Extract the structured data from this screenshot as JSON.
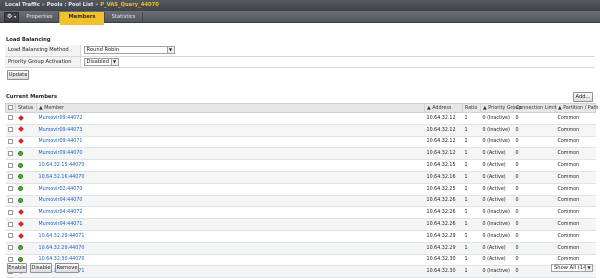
{
  "breadcrumb": {
    "part1": "Local Traffic",
    "sep": "»",
    "part2": "Pools : Pool List",
    "part3": "P_VAS_Query_44070"
  },
  "tabs": [
    {
      "label": "Properties"
    },
    {
      "label": "Members"
    },
    {
      "label": "Statistics"
    }
  ],
  "load_balancing": {
    "title": "Load Balancing",
    "method_label": "Load Balancing Method",
    "method_value": "Round Robin",
    "priority_label": "Priority Group Activation",
    "priority_value": "Disabled",
    "update_button": "Update"
  },
  "members": {
    "title": "Current Members",
    "add_button": "Add...",
    "columns": {
      "status": "Status",
      "member": "Member",
      "address": "Address",
      "ratio": "Ratio",
      "priority": "Priority Group",
      "connlimit": "Connection Limit",
      "partition": "Partition / Path"
    },
    "rows": [
      {
        "status": "red",
        "member": "Mumovir09:44072",
        "address": "10.64.32.12",
        "ratio": "1",
        "priority": "0 (Inactive)",
        "connlimit": "0",
        "partition": "Common"
      },
      {
        "status": "red",
        "member": "Mumovir09:44073",
        "address": "10.64.32.12",
        "ratio": "1",
        "priority": "0 (Inactive)",
        "connlimit": "0",
        "partition": "Common"
      },
      {
        "status": "red",
        "member": "Mumovir09:44071",
        "address": "10.64.32.12",
        "ratio": "1",
        "priority": "0 (Inactive)",
        "connlimit": "0",
        "partition": "Common"
      },
      {
        "status": "green",
        "member": "Mumovir09:44070",
        "address": "10.64.32.12",
        "ratio": "1",
        "priority": "0 (Active)",
        "connlimit": "0",
        "partition": "Common"
      },
      {
        "status": "green",
        "member": "10.64.32.15:44070",
        "address": "10.64.32.15",
        "ratio": "1",
        "priority": "0 (Active)",
        "connlimit": "0",
        "partition": "Common"
      },
      {
        "status": "green",
        "member": "10.64.32.16:44070",
        "address": "10.64.32.16",
        "ratio": "1",
        "priority": "0 (Active)",
        "connlimit": "0",
        "partition": "Common"
      },
      {
        "status": "green",
        "member": "Mumovir02:44070",
        "address": "10.64.32.25",
        "ratio": "1",
        "priority": "0 (Active)",
        "connlimit": "0",
        "partition": "Common"
      },
      {
        "status": "green",
        "member": "Mumovir04:44070",
        "address": "10.64.32.26",
        "ratio": "1",
        "priority": "0 (Active)",
        "connlimit": "0",
        "partition": "Common"
      },
      {
        "status": "red",
        "member": "Mumovir04:44072",
        "address": "10.64.32.26",
        "ratio": "1",
        "priority": "0 (Inactive)",
        "connlimit": "0",
        "partition": "Common"
      },
      {
        "status": "red",
        "member": "Mumovir04:44071",
        "address": "10.64.32.26",
        "ratio": "1",
        "priority": "0 (Inactive)",
        "connlimit": "0",
        "partition": "Common"
      },
      {
        "status": "red",
        "member": "10.64.32.29:44071",
        "address": "10.64.32.29",
        "ratio": "1",
        "priority": "0 (Inactive)",
        "connlimit": "0",
        "partition": "Common"
      },
      {
        "status": "green",
        "member": "10.64.32.29:44070",
        "address": "10.64.32.29",
        "ratio": "1",
        "priority": "0 (Active)",
        "connlimit": "0",
        "partition": "Common"
      },
      {
        "status": "green",
        "member": "10.64.32.30:44070",
        "address": "10.64.32.30",
        "ratio": "1",
        "priority": "0 (Active)",
        "connlimit": "0",
        "partition": "Common"
      },
      {
        "status": "red",
        "member": "10.64.32.30:44071",
        "address": "10.64.32.30",
        "ratio": "1",
        "priority": "0 (Inactive)",
        "connlimit": "0",
        "partition": "Common"
      }
    ],
    "enable_button": "Enable",
    "disable_button": "Disable",
    "remove_button": "Remove",
    "show_select": "Show All (14)"
  },
  "colors": {
    "accent_tab": "#f0c12a",
    "status_green": "#4caf2e",
    "status_red": "#d8231f",
    "link": "#1d5fbf"
  }
}
